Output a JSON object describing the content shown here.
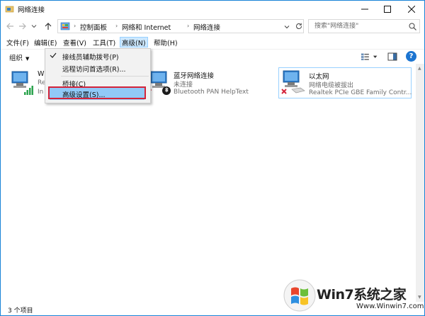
{
  "window": {
    "title": "网络连接"
  },
  "address": {
    "crumbs": [
      "控制面板",
      "网络和 Internet",
      "网络连接"
    ],
    "search_placeholder": "搜索\"网络连接\""
  },
  "menubar": {
    "items": [
      {
        "label": "文件(F)"
      },
      {
        "label": "编辑(E)"
      },
      {
        "label": "查看(V)"
      },
      {
        "label": "工具(T)"
      },
      {
        "label": "高级(N)",
        "active": true
      },
      {
        "label": "帮助(H)"
      }
    ]
  },
  "toolbar": {
    "organize_label": "组织",
    "help_label": "?"
  },
  "advanced_menu": {
    "items": [
      {
        "label": "接线员辅助拨号(P)",
        "checked": true
      },
      {
        "label": "远程访问首选项(R)..."
      },
      {
        "label": "桥接(C)"
      },
      {
        "label": "高级设置(S)...",
        "highlighted": true
      }
    ]
  },
  "connections": [
    {
      "name": "W",
      "status": "Re",
      "device": "In",
      "type": "wifi"
    },
    {
      "name": "蓝牙网络连接",
      "status": "未连接",
      "device": "Bluetooth PAN HelpText",
      "type": "bluetooth"
    },
    {
      "name": "以太网",
      "status": "网络电缆被拔出",
      "device": "Realtek PCIe GBE Family Contr...",
      "type": "ethernet"
    }
  ],
  "statusbar": {
    "count": "3 个项目"
  },
  "watermark": {
    "text": "Win7系统之家",
    "url": "Www.Winwin7.com"
  },
  "colors": {
    "accent": "#1883d7",
    "menu_active_bg": "#cce8ff",
    "highlight_bg": "#91c9f7",
    "red_outline": "#d3233a"
  }
}
